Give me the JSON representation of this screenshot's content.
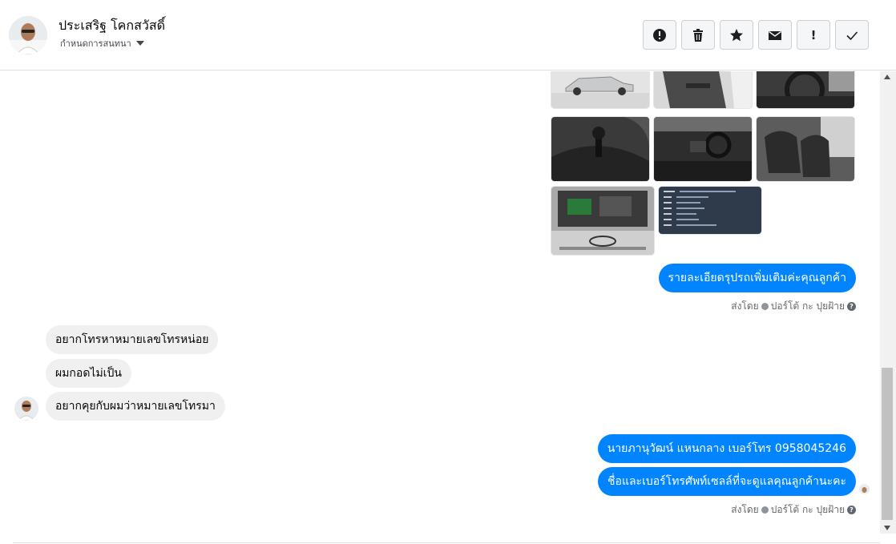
{
  "header": {
    "contact_name": "ประเสริฐ โคกสวัสดิ์",
    "conversation_settings": "กำหนดการสนทนา"
  },
  "toolbar": {
    "buttons": [
      {
        "icon": "alert-circle-icon"
      },
      {
        "icon": "trash-icon"
      },
      {
        "icon": "star-icon"
      },
      {
        "icon": "envelope-icon"
      },
      {
        "icon": "exclamation-icon",
        "glyph": "!"
      },
      {
        "icon": "check-icon"
      }
    ]
  },
  "thread": {
    "outgoing_1": "รายละเอียดรุปรถเพิ่มเติมค่ะคุณลูกค้า",
    "sent_by_1": {
      "label": "ส่งโดย",
      "sender": "ปอร์โต้ กะ ปุยฝ้าย"
    },
    "incoming": [
      "อยากโทรหาหมายเลขโทรหน่อย",
      "ผมกอดไม่เป็น",
      "อยากคุยกับผมว่าหมายเลขโทรมา"
    ],
    "outgoing_2": "นายภานุวัฒน์ แหนกลาง เบอร์โทร 0958045246",
    "outgoing_3": "ชื่อและเบอร์โทรศัพท์เซลล์ที่จะดูแลคุณลูกค้านะคะ",
    "sent_by_2": {
      "label": "ส่งโดย",
      "sender": "ปอร์โต้ กะ ปุยฝ้าย"
    }
  },
  "colors": {
    "outgoing_bubble": "#0084ff",
    "incoming_bubble": "#f1f0f0"
  }
}
